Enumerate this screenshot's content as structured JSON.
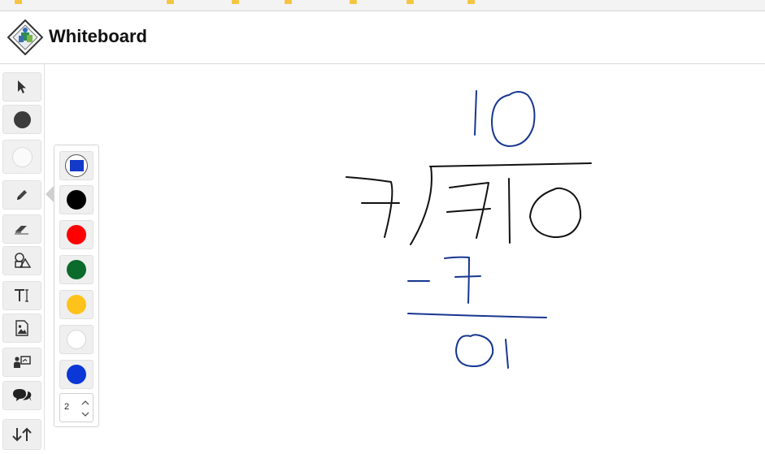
{
  "app": {
    "title": "Whiteboard"
  },
  "toolbar": {
    "tools": [
      "select-icon",
      "color-dot-icon",
      "light-dot-icon",
      "pencil-icon",
      "eraser-icon",
      "shapes-icon",
      "text-icon",
      "image-icon",
      "presenter-icon",
      "chat-icon",
      "sort-arrows-icon"
    ]
  },
  "palette": {
    "colors": [
      "#1339c9",
      "#000000",
      "#ff0000",
      "#0a6b2a",
      "#ffc21a",
      "#ffffff",
      "#0a37d6"
    ],
    "selected": "#1339c9",
    "stroke_width": "2"
  },
  "colors": {
    "ink_black": "#111111",
    "ink_blue": "#17378f"
  }
}
